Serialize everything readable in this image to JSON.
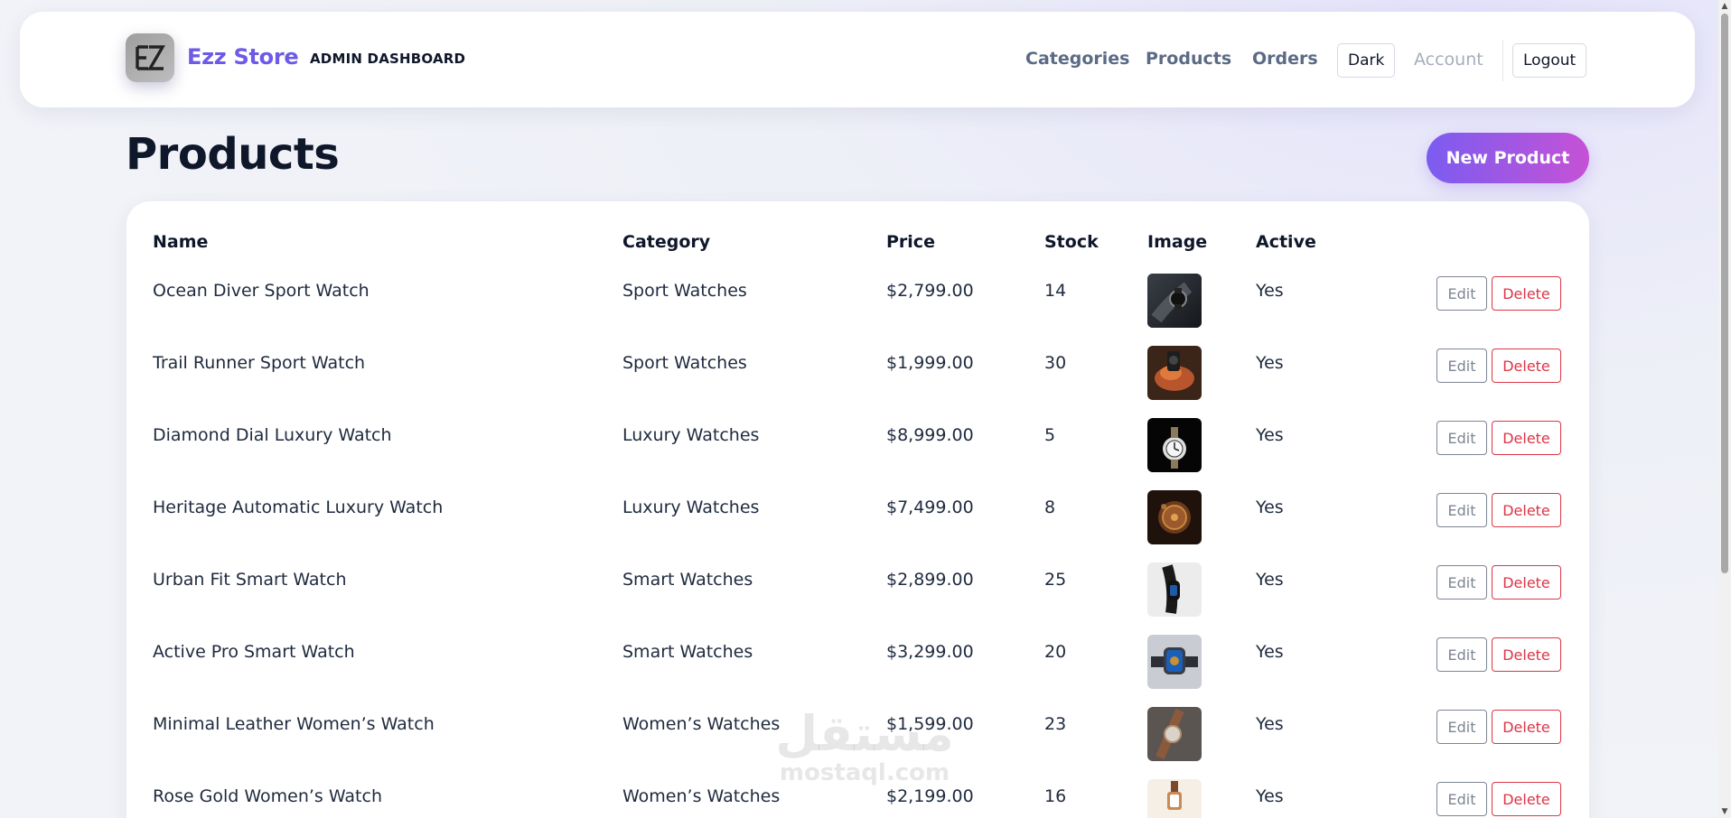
{
  "header": {
    "brand": "Ezz Store",
    "subtitle": "ADMIN DASHBOARD",
    "nav": {
      "categories": "Categories",
      "products": "Products",
      "orders": "Orders",
      "dark": "Dark",
      "account": "Account",
      "logout": "Logout"
    }
  },
  "page": {
    "title": "Products",
    "new_button": "New Product"
  },
  "table": {
    "columns": {
      "name": "Name",
      "category": "Category",
      "price": "Price",
      "stock": "Stock",
      "image": "Image",
      "active": "Active"
    },
    "edit_label": "Edit",
    "delete_label": "Delete",
    "rows": [
      {
        "name": "Ocean Diver Sport Watch",
        "category": "Sport Watches",
        "price": "$2,799.00",
        "stock": "14",
        "active": "Yes"
      },
      {
        "name": "Trail Runner Sport Watch",
        "category": "Sport Watches",
        "price": "$1,999.00",
        "stock": "30",
        "active": "Yes"
      },
      {
        "name": "Diamond Dial Luxury Watch",
        "category": "Luxury Watches",
        "price": "$8,999.00",
        "stock": "5",
        "active": "Yes"
      },
      {
        "name": "Heritage Automatic Luxury Watch",
        "category": "Luxury Watches",
        "price": "$7,499.00",
        "stock": "8",
        "active": "Yes"
      },
      {
        "name": "Urban Fit Smart Watch",
        "category": "Smart Watches",
        "price": "$2,899.00",
        "stock": "25",
        "active": "Yes"
      },
      {
        "name": "Active Pro Smart Watch",
        "category": "Smart Watches",
        "price": "$3,299.00",
        "stock": "20",
        "active": "Yes"
      },
      {
        "name": "Minimal Leather Women’s Watch",
        "category": "Women’s Watches",
        "price": "$1,599.00",
        "stock": "23",
        "active": "Yes"
      },
      {
        "name": "Rose Gold Women’s Watch",
        "category": "Women’s Watches",
        "price": "$2,199.00",
        "stock": "16",
        "active": "Yes"
      }
    ]
  },
  "watermark": {
    "top": "مستقل",
    "bottom": "mostaql.com"
  },
  "colors": {
    "brand": "#6d5ae6",
    "danger": "#dc3545",
    "gradient_start": "#7b5cf0",
    "gradient_end": "#c552d6"
  }
}
